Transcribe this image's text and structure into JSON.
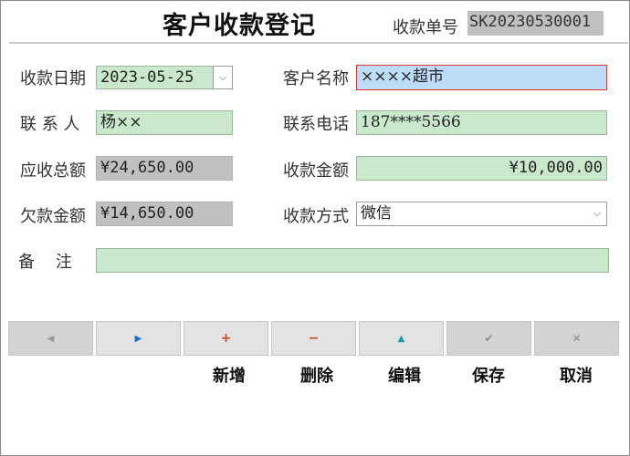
{
  "header": {
    "title": "客户收款登记",
    "order_label": "收款单号",
    "order_no": "SK20230530001"
  },
  "form": {
    "date_label": "收款日期",
    "date_value": "2023-05-25",
    "customer_label": "客户名称",
    "customer_value": "××××超市",
    "contact_label": "联 系 人",
    "contact_value": "杨××",
    "phone_label": "联系电话",
    "phone_value": "187****5566",
    "receivable_label": "应收总额",
    "receivable_value": "¥24,650.00",
    "received_label": "收款金额",
    "received_value": "¥10,000.00",
    "owed_label": "欠款金额",
    "owed_value": "¥14,650.00",
    "method_label": "收款方式",
    "method_value": "微信",
    "remark_label": "备    注",
    "remark_value": ""
  },
  "toolbar": {
    "new_label": "新增",
    "delete_label": "删除",
    "edit_label": "编辑",
    "save_label": "保存",
    "cancel_label": "取消"
  },
  "icons": {
    "prev": "triangle-left-icon",
    "next": "triangle-right-icon",
    "add": "plus-icon",
    "delete": "minus-icon",
    "edit": "triangle-up-icon",
    "save": "check-icon",
    "cancel": "x-icon"
  },
  "colors": {
    "input_green": "#c9e8cc",
    "readonly_gray": "#c0c0c0",
    "focus_blue": "#bcdcf7",
    "focus_border": "#d83a3a"
  }
}
